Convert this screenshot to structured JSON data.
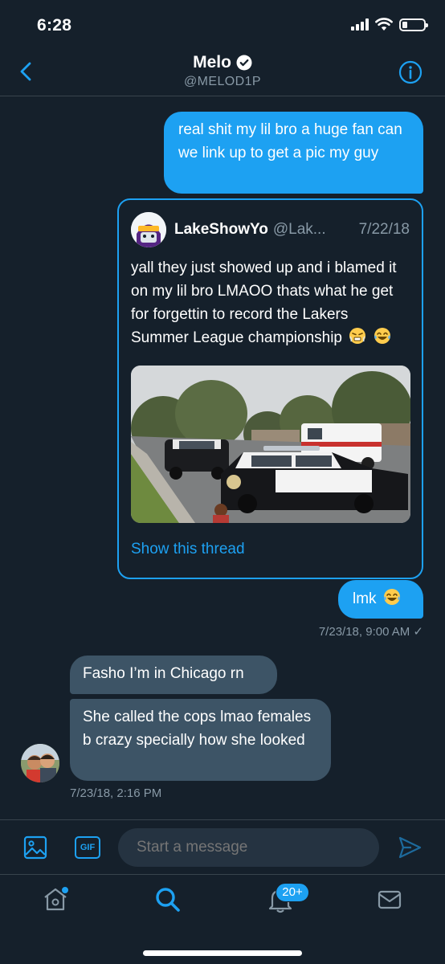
{
  "status_bar": {
    "time": "6:28"
  },
  "header": {
    "name": "Melo",
    "handle": "@MELOD1P"
  },
  "messages": {
    "outgoing_1": "real shit my lil bro a huge fan can we link up to get a pic my guy",
    "tweet": {
      "author_name": "LakeShowYo",
      "author_handle": "@Lak...",
      "date": "7/22/18",
      "text": "yall they just showed up and i blamed it on my lil bro LMAOO thats what he get for forgettin to record the Lakers Summer League championship",
      "show_thread": "Show this thread"
    },
    "outgoing_2": "lmk",
    "outgoing_timestamp": "7/23/18, 9:00 AM ✓",
    "incoming_1": "Fasho I’m in Chicago rn",
    "incoming_2": "She called the cops lmao females b crazy specially how she looked",
    "incoming_timestamp": "7/23/18, 2:16 PM"
  },
  "composer": {
    "gif_label": "GIF",
    "placeholder": "Start a message"
  },
  "tabbar": {
    "notifications_badge": "20+"
  },
  "colors": {
    "background": "#15202b",
    "accent": "#1da1f2",
    "incoming_bubble": "#3d5466",
    "muted_text": "#8899a6"
  }
}
